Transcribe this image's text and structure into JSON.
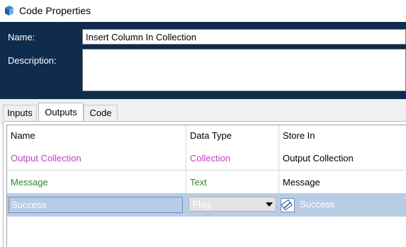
{
  "window": {
    "title": "Code Properties"
  },
  "form": {
    "name_label": "Name:",
    "name_value": "Insert Column In Collection",
    "description_label": "Description:",
    "description_value": ""
  },
  "tabs": [
    {
      "label": "Inputs",
      "selected": false
    },
    {
      "label": "Outputs",
      "selected": true
    },
    {
      "label": "Code",
      "selected": false
    }
  ],
  "grid": {
    "columns": [
      "Name",
      "Data Type",
      "Store In"
    ],
    "rows": [
      {
        "name": "Output Collection",
        "type": "Collection",
        "store": "Output Collection",
        "name_color": "#c13fc1",
        "type_color": "#c13fc1"
      },
      {
        "name": "Message",
        "type": "Text",
        "store": "Message",
        "name_color": "#2a8a2a",
        "type_color": "#2a8a2a"
      },
      {
        "name": "Success",
        "type": "Flag",
        "store": "Success",
        "selected": true
      }
    ]
  },
  "colors": {
    "header_bg": "#0f2b4d",
    "selection": "#b9cce6"
  },
  "icons": {
    "app": "blueprism-icon",
    "store_picker": "data-item-pencil-icon",
    "dropdown": "chevron-down-icon"
  }
}
